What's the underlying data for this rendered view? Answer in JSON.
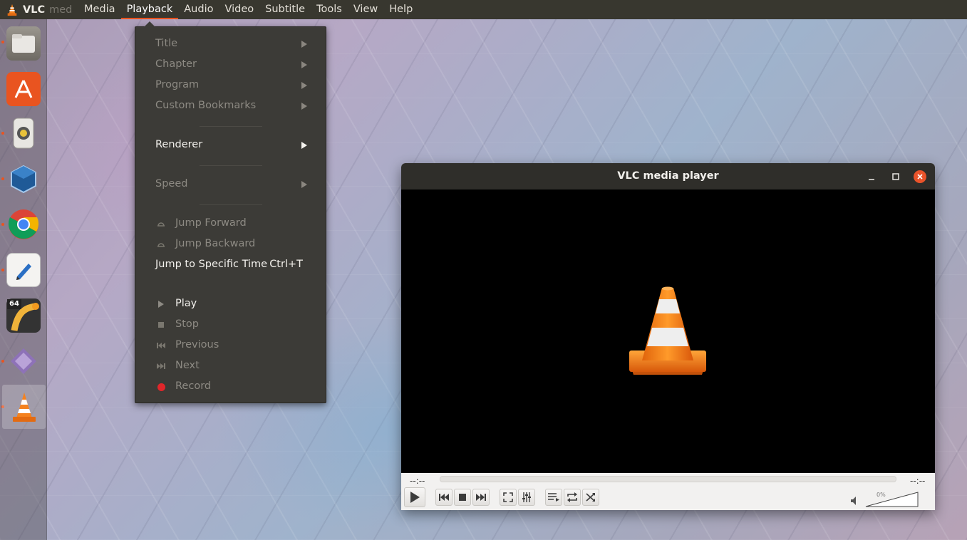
{
  "topbar": {
    "app_name": "VLC",
    "app_name_faded": "med",
    "menus": [
      "Media",
      "Playback",
      "Audio",
      "Video",
      "Subtitle",
      "Tools",
      "View",
      "Help"
    ],
    "active_menu": "Playback"
  },
  "dock": {
    "items": [
      "files-icon",
      "software-center-icon",
      "rhythmbox-icon",
      "virtualbox-icon",
      "chrome-icon",
      "text-editor-icon",
      "pcsx2-64-icon",
      "other-app-icon",
      "vlc-icon"
    ],
    "badge_64": "64"
  },
  "playback_menu": {
    "title": "Title",
    "chapter": "Chapter",
    "program": "Program",
    "custom_bookmarks": "Custom Bookmarks",
    "renderer": "Renderer",
    "speed": "Speed",
    "jump_forward": "Jump Forward",
    "jump_backward": "Jump Backward",
    "jump_specific": "Jump to Specific Time",
    "jump_specific_shortcut": "Ctrl+T",
    "play": "Play",
    "stop": "Stop",
    "previous": "Previous",
    "next": "Next",
    "record": "Record"
  },
  "vlc_window": {
    "title": "VLC media player",
    "time_elapsed": "--:--",
    "time_total": "--:--",
    "volume_percent": "0%"
  },
  "colors": {
    "accent": "#e95420",
    "menu_bg": "#3c3b37",
    "topbar_bg": "#38372f",
    "record_red": "#e0262a"
  }
}
